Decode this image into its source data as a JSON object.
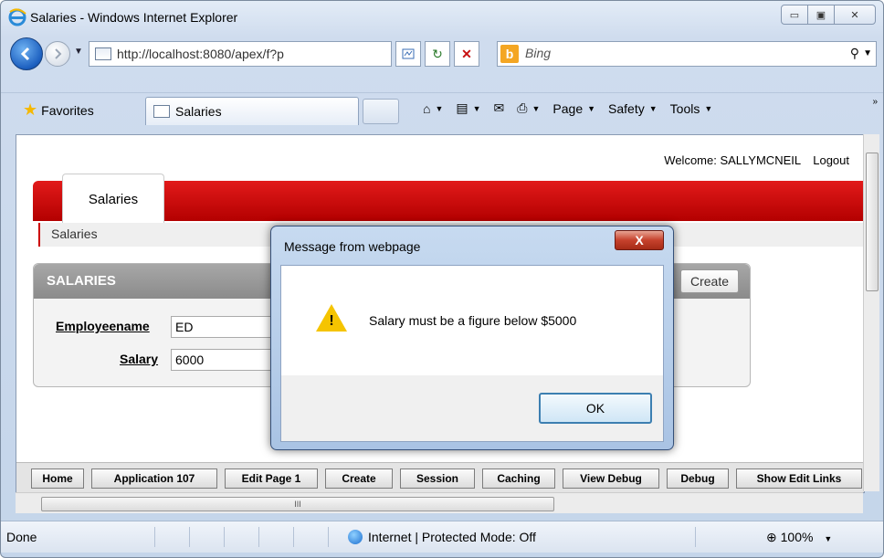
{
  "window": {
    "title": "Salaries - Windows Internet Explorer",
    "minimize": "▭",
    "maximize": "▣",
    "close": "✕"
  },
  "address": {
    "url": "http://localhost:8080/apex/f?p"
  },
  "search": {
    "placeholder": "Bing"
  },
  "favorites": {
    "label": "Favorites"
  },
  "tab": {
    "label": "Salaries"
  },
  "commands": {
    "page": "Page",
    "safety": "Safety",
    "tools": "Tools"
  },
  "page": {
    "welcome": "Welcome: SALLYMCNEIL",
    "logout": "Logout",
    "tab_label": "Salaries",
    "breadcrumb": "Salaries",
    "region_title": "SALARIES",
    "create_button": "Create",
    "fields": {
      "employeename_label": "Employeename",
      "employeename_value": "ED",
      "salary_label": "Salary",
      "salary_value": "6000"
    }
  },
  "devbar": [
    "Home",
    "Application 107",
    "Edit Page 1",
    "Create",
    "Session",
    "Caching",
    "View Debug",
    "Debug",
    "Show Edit Links"
  ],
  "status": {
    "left": "Done",
    "zone": "Internet | Protected Mode: Off",
    "zoom": "100%"
  },
  "dialog": {
    "title": "Message from webpage",
    "close": "X",
    "message": "Salary must be a figure below $5000",
    "icon": "warning-icon",
    "ok": "OK"
  },
  "scroll": {
    "h_grip": "III"
  }
}
